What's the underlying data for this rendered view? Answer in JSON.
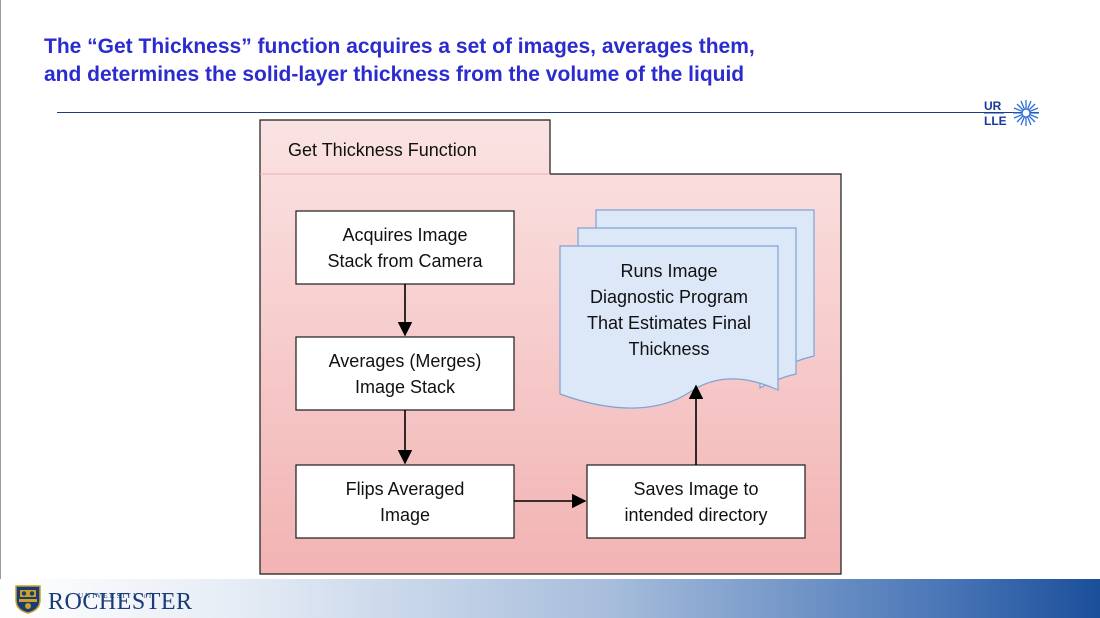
{
  "slide": {
    "title_line1": "The “Get Thickness” function acquires a set of images, averages them,",
    "title_line2": "and determines the solid-layer thickness from the volume of the liquid"
  },
  "logos": {
    "urlle_top": "UR",
    "urlle_bottom": "LLE",
    "university_small": "UNIVERSITY of",
    "university_name": "ROCHESTER"
  },
  "diagram": {
    "container_label": "Get Thickness Function",
    "nodes": {
      "acquire": [
        "Acquires Image",
        "Stack from Camera"
      ],
      "average": [
        "Averages (Merges)",
        "Image Stack"
      ],
      "flip": [
        "Flips Averaged",
        "Image"
      ],
      "save": [
        "Saves Image to",
        "intended directory"
      ],
      "diagnostic": [
        "Runs Image",
        "Diagnostic Program",
        "That Estimates Final",
        "Thickness"
      ]
    },
    "edges": [
      {
        "from": "acquire",
        "to": "average"
      },
      {
        "from": "average",
        "to": "flip"
      },
      {
        "from": "flip",
        "to": "save"
      },
      {
        "from": "save",
        "to": "diagnostic"
      }
    ]
  },
  "colors": {
    "title": "#2b2bd0",
    "container_top": "#fbe3e3",
    "container_bottom": "#f2b3b3",
    "document_fill": "#dce8f8",
    "document_stroke": "#7fa2d4",
    "rule": "#1c3f7a",
    "brand": "#1a3a78"
  }
}
